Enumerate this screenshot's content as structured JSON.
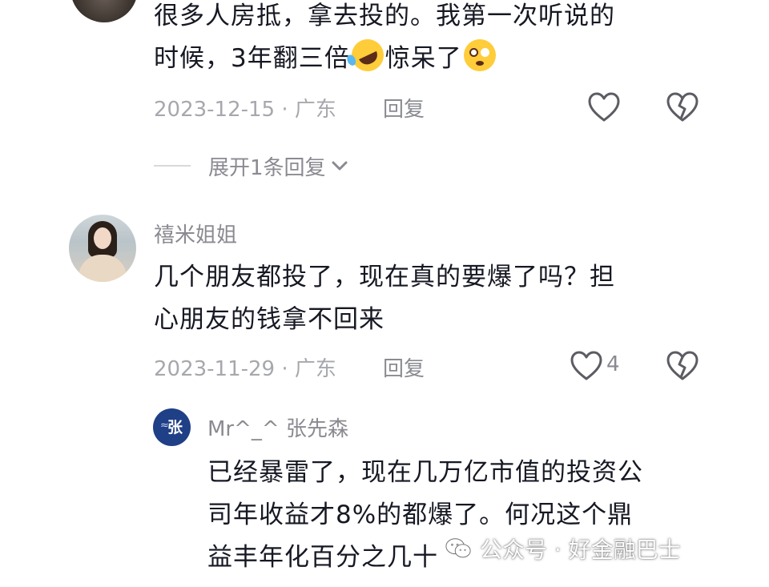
{
  "comments": [
    {
      "text_lines": [
        "很多人房抵，拿去投的。我第一次听说的",
        "时候，3年翻三倍",
        "惊呆了"
      ],
      "emojis": [
        "rolling-on-floor-laughing",
        "flushed-face"
      ],
      "date": "2023-12-15",
      "location": "广东",
      "reply_label": "回复",
      "expand_label": "展开1条回复"
    },
    {
      "username": "禧米姐姐",
      "text_lines": [
        "几个朋友都投了，现在真的要爆了吗？担",
        "心朋友的钱拿不回来"
      ],
      "date": "2023-11-29",
      "location": "广东",
      "reply_label": "回复",
      "like_count": "4"
    }
  ],
  "reply": {
    "username": "Mr^_^ 张先森",
    "avatar_glyph": "张",
    "text_lines": [
      "已经暴雷了，现在几万亿市值的投资公",
      "司年收益才8%的都爆了。何况这个鼎",
      "益丰年化百分之几十"
    ]
  },
  "watermark": {
    "text": "公众号 · 好金融巴士"
  },
  "separator": " · ",
  "colors": {
    "text_primary": "#161823",
    "text_secondary": "#8a8b91",
    "text_meta": "#a6a8ad",
    "icon": "#5c5d63"
  },
  "icons": {
    "like": "heart-outline-icon",
    "dislike": "broken-heart-icon",
    "chevron": "chevron-down-icon"
  }
}
